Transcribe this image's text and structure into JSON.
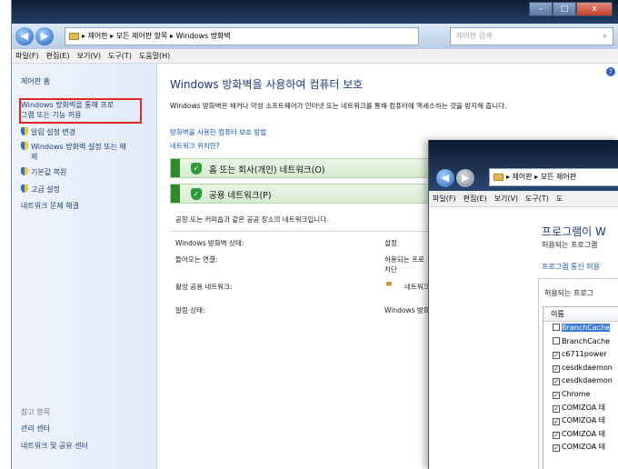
{
  "back_window": {
    "caption": {
      "min": "–",
      "max": "□",
      "close": "x"
    },
    "address": {
      "path": "▸ 제어판 ▸ 모든 제어판 항목 ▸ Windows 방화벽",
      "search_placeholder": "제어판 검색"
    },
    "menu": [
      "파일(F)",
      "편집(E)",
      "보기(V)",
      "도구(T)",
      "도움말(H)"
    ],
    "sidebar": {
      "home": "제어판 홈",
      "allow_program_line1": "Windows 방화벽을 통해 프로",
      "allow_program_line2": "그램 또는 기능 허용",
      "notifications": "알림 설정 변경",
      "onoff_line1": "Windows 방화벽 설정 또는 해",
      "onoff_line2": "제",
      "restore": "기본값 복원",
      "advanced": "고급 설정",
      "troubleshoot": "네트워크 문제 해결",
      "see_also": "참고 항목",
      "action_center": "관리 센터",
      "network_center": "네트워크 및 공유 센터"
    },
    "main": {
      "title": "Windows 방화벽을 사용하여 컴퓨터 보호",
      "desc": "Windows 방화벽은 해커나 악성 소프트웨어가 인터넷 또는 네트워크를 통해 컴퓨터에 액세스하는 것을 방지해 줍니다.",
      "link1": "방화벽을 사용한 컴퓨터 보호 방법",
      "link2": "네트워크 위치란?",
      "net_home": "홈 또는 회사(개인) 네트워크(O)",
      "net_public": "공용 네트워크(P)",
      "public_desc": "공항 또는 커피숍과 같은 공공 장소의 네트워크입니다.",
      "rows": [
        {
          "label": "Windows 방화벽 상태:",
          "value": "설정"
        },
        {
          "label": "들어오는 연결:",
          "value": "허용되는 프로",
          "value2": "차단"
        },
        {
          "label": "활성 공용 네트워크:",
          "value": "네트워크"
        },
        {
          "label": "알림 상태:",
          "value": "Windows 방화"
        }
      ]
    }
  },
  "front_window": {
    "address": "▸ 제어판 ▸ 모든 제어판",
    "menu": [
      "파일(F)",
      "편집(E)",
      "보기(V)",
      "도구(T)",
      "도"
    ],
    "title": "프로그램이 W",
    "subtitle": "허용되는 프로그램",
    "link": "프로그램 통신 허용",
    "panel_header": "허용되는 프로그",
    "list_header": "이름",
    "items": [
      {
        "name": "BranchCache",
        "checked": false,
        "selected": true
      },
      {
        "name": "BranchCache",
        "checked": false,
        "selected": false
      },
      {
        "name": "c6711power",
        "checked": true,
        "selected": false
      },
      {
        "name": "cesdkdaemon",
        "checked": true,
        "selected": false
      },
      {
        "name": "cesdkdaemon",
        "checked": true,
        "selected": false
      },
      {
        "name": "Chrome",
        "checked": true,
        "selected": false
      },
      {
        "name": "COMIZOA 테",
        "checked": true,
        "selected": false
      },
      {
        "name": "COMIZOA 테",
        "checked": true,
        "selected": false
      },
      {
        "name": "COMIZOA 테",
        "checked": true,
        "selected": false
      },
      {
        "name": "COMIZOA 테",
        "checked": true,
        "selected": false
      }
    ]
  }
}
